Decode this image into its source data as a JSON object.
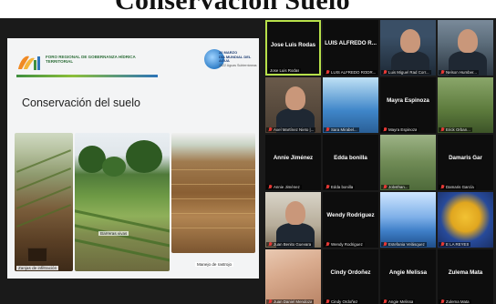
{
  "banner": {
    "headline": "Conservación Suelo"
  },
  "slide": {
    "forum_logo_text": "FORO REGIONAL DE GOBERNANZA HÍDRICA TERRITORIAL",
    "event_text_top": "22 MARZO",
    "event_text_main": "DÍA MUNDIAL DEL AGUA",
    "event_text_sub": "2022 Aguas Subterráneas",
    "title": "Conservación del suelo",
    "captions": {
      "trench": "Zanjas de infiltración",
      "barriers": "Barreras vivas",
      "stubble": "Manejo de rastrojo"
    }
  },
  "participants": [
    {
      "name": "Jose Luis Rodas",
      "label": "Jose Luis Rodas",
      "video": false,
      "active": true,
      "muted": false
    },
    {
      "name": "LUIS ALFREDO R...",
      "label": "LUIS ALFREDO RODR...",
      "video": false,
      "active": false,
      "muted": true
    },
    {
      "name": "",
      "label": "Luis Miguel Rad Corr...",
      "video": true,
      "style": "v-suit",
      "muted": true
    },
    {
      "name": "",
      "label": "Nelson Humber...",
      "video": true,
      "style": "v-suit2",
      "muted": true
    },
    {
      "name": "",
      "label": "Axel Martínez Nieto |...",
      "video": true,
      "style": "v-office",
      "muted": true
    },
    {
      "name": "",
      "label": "Sara Mirabel...",
      "video": true,
      "style": "v-blue",
      "muted": true
    },
    {
      "name": "Mayra Espinoza",
      "label": "Mayra Espinoza",
      "video": false,
      "muted": true
    },
    {
      "name": "",
      "label": "Erick Orban...",
      "video": true,
      "style": "v-nature",
      "muted": true
    },
    {
      "name": "Annie Jiménez",
      "label": "Annie Jiménez",
      "video": false,
      "muted": true
    },
    {
      "name": "Edda bonilla",
      "label": "Edda bonilla",
      "video": false,
      "muted": true
    },
    {
      "name": "",
      "label": "Jobsthan...",
      "video": true,
      "style": "v-plant",
      "muted": true
    },
    {
      "name": "Damaris Gar",
      "label": "Damaris García",
      "video": false,
      "muted": true
    },
    {
      "name": "",
      "label": "Juan Benito Guevara",
      "video": true,
      "style": "v-hall",
      "muted": true
    },
    {
      "name": "Wendy Rodriguez",
      "label": "Wendy Rodriguez",
      "video": false,
      "muted": true
    },
    {
      "name": "",
      "label": "Estefania Velásquez",
      "video": true,
      "style": "v-sky",
      "muted": true
    },
    {
      "name": "",
      "label": "E LA REYES",
      "video": true,
      "style": "v-lion",
      "muted": true
    },
    {
      "name": "",
      "label": "Juan Daniel Mendoza",
      "video": true,
      "style": "v-skin",
      "muted": true
    },
    {
      "name": "Cindy Ordoñez",
      "label": "Cindy Ordoñez",
      "video": false,
      "muted": true
    },
    {
      "name": "Angie Melissa",
      "label": "Angie Melissa",
      "video": false,
      "muted": true
    },
    {
      "name": "Zulema Mata",
      "label": "Zulema Mata",
      "video": false,
      "muted": true
    }
  ],
  "colors": {
    "active_border": "#b7e04a",
    "mic_muted": "#e53935",
    "tile_bg": "#0d0d0d"
  }
}
